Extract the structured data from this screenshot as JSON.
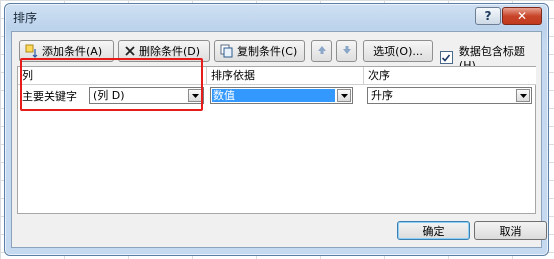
{
  "window": {
    "title": "排序",
    "help_label": "?",
    "close_label": "✕"
  },
  "toolbar": {
    "add_label": "添加条件(A)",
    "delete_label": "删除条件(D)",
    "copy_label": "复制条件(C)",
    "options_label": "选项(O)...",
    "header_checkbox_label": "数据包含标题(H)",
    "header_checkbox_checked": true
  },
  "grid": {
    "columns": [
      "列",
      "排序依据",
      "次序"
    ],
    "row": {
      "label": "主要关键字",
      "column_value": "(列 D)",
      "sort_on_value": "数值",
      "order_value": "升序"
    }
  },
  "footer": {
    "ok_label": "确定",
    "cancel_label": "取消"
  },
  "colors": {
    "highlight": "#e81b1b",
    "selection": "#3399ff"
  },
  "icons": [
    "add-condition-icon",
    "delete-x-icon",
    "copy-icon",
    "move-up-icon",
    "move-down-icon",
    "checkmark-icon",
    "dropdown-arrow-icon"
  ]
}
